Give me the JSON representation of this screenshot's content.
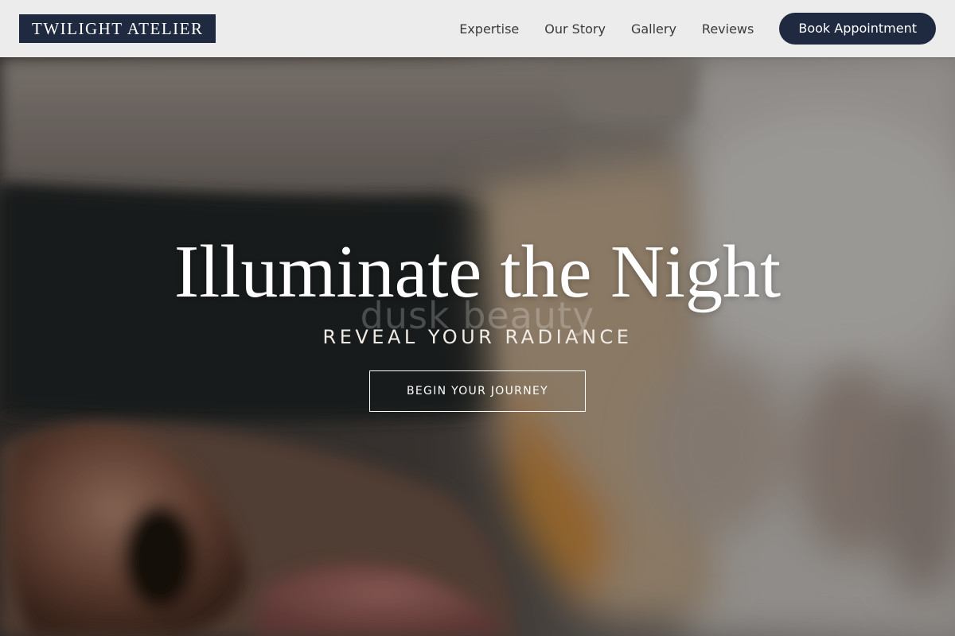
{
  "brand": {
    "logo_text": "TWILIGHT ATELIER",
    "primary_color": "#1f2a40"
  },
  "nav": {
    "links": [
      {
        "label": "Expertise"
      },
      {
        "label": "Our Story"
      },
      {
        "label": "Gallery"
      },
      {
        "label": "Reviews"
      }
    ],
    "cta_label": "Book Appointment"
  },
  "hero": {
    "title": "Illuminate the Night",
    "subtitle": "REVEAL YOUR RADIANCE",
    "watermark": "dusk beauty",
    "cta_label": "BEGIN YOUR JOURNEY",
    "background_image": "close-up of a face receiving a skincare treatment"
  }
}
